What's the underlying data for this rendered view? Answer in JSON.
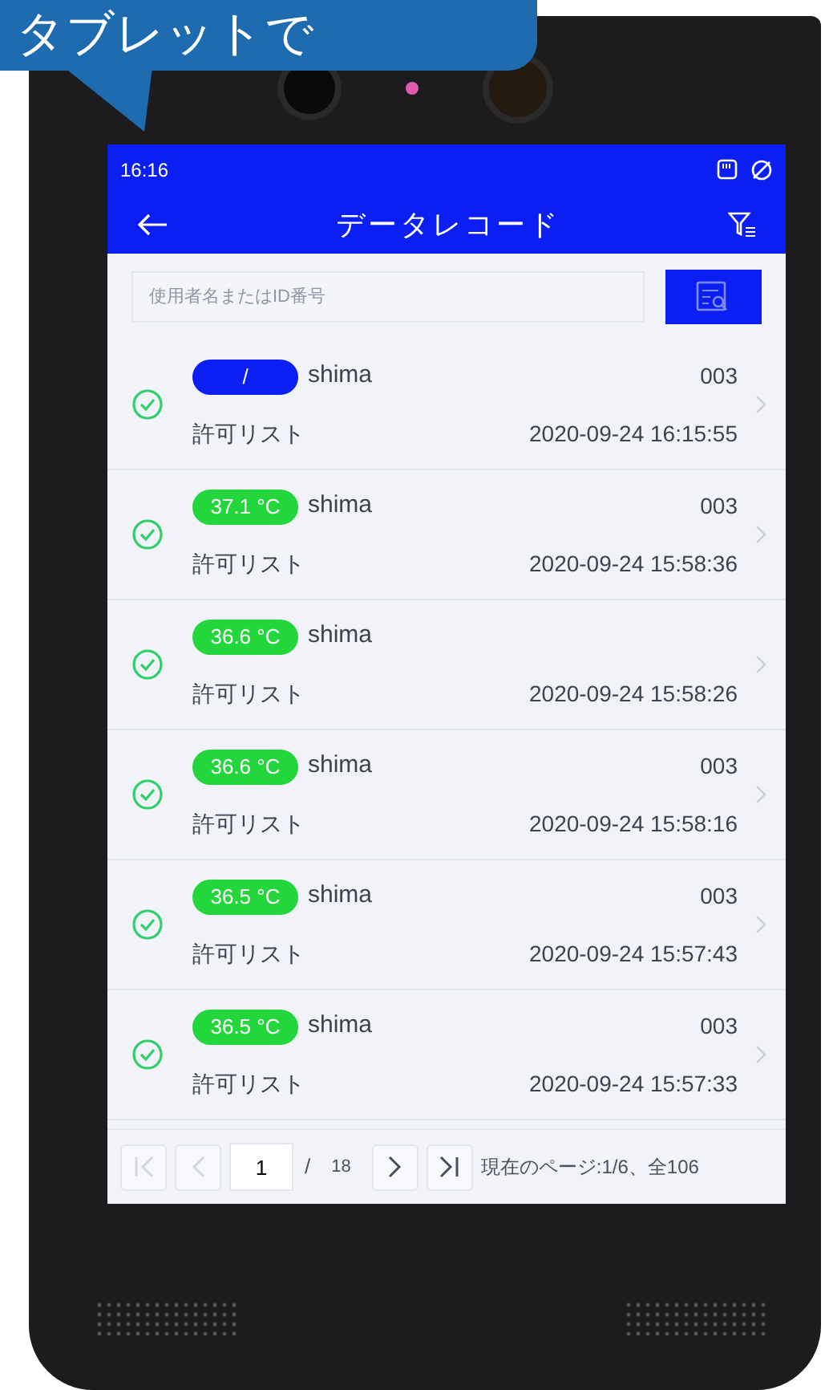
{
  "callout": {
    "text": "タブレットで"
  },
  "status_bar": {
    "time": "16:16"
  },
  "header": {
    "title": "データレコード"
  },
  "search": {
    "placeholder": "使用者名またはID番号"
  },
  "records": [
    {
      "kind": "unmeasured",
      "badge": "/",
      "name": "shima",
      "code": "003",
      "list": "許可リスト",
      "time": "2020-09-24 16:15:55",
      "verified": true
    },
    {
      "kind": "measured",
      "badge": "37.1 °C",
      "name": "shima",
      "code": "003",
      "list": "許可リスト",
      "time": "2020-09-24 15:58:36",
      "verified": true
    },
    {
      "kind": "measured",
      "badge": "36.6 °C",
      "name": "shima",
      "list": "許可リスト",
      "time": "2020-09-24 15:58:26",
      "verified": true
    },
    {
      "kind": "measured",
      "badge": "36.6 °C",
      "name": "shima",
      "code": "003",
      "list": "許可リスト",
      "time": "2020-09-24 15:58:16",
      "verified": true
    },
    {
      "kind": "measured",
      "badge": "36.5 °C",
      "name": "shima",
      "code": "003",
      "list": "許可リスト",
      "time": "2020-09-24 15:57:43",
      "verified": true
    },
    {
      "kind": "measured",
      "badge": "36.5 °C",
      "name": "shima",
      "code": "003",
      "list": "許可リスト",
      "time": "2020-09-24 15:57:33",
      "verified": true
    }
  ],
  "pagination": {
    "page": "1",
    "separator": "/",
    "total_pages": "18",
    "summary": "現在のページ:1/6、全106",
    "buttons": [
      {
        "kind": "first",
        "disabled": true
      },
      {
        "kind": "previous",
        "disabled": true
      },
      {
        "kind": "next",
        "disabled": false
      },
      {
        "kind": "last",
        "disabled": false
      }
    ]
  }
}
